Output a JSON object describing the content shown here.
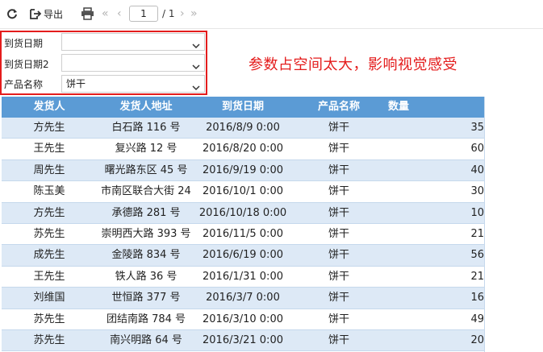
{
  "toolbar": {
    "export_label": "导出",
    "page_current": "1",
    "page_total": "/ 1",
    "icons": [
      "refresh-icon",
      "export-icon",
      "print-icon",
      "first-page-icon",
      "prev-page-icon",
      "next-page-icon",
      "last-page-icon"
    ]
  },
  "params": [
    {
      "label": "到货日期",
      "value": ""
    },
    {
      "label": "到货日期2",
      "value": ""
    },
    {
      "label": "产品名称",
      "value": "饼干"
    }
  ],
  "annotation": "参数占空间太大，影响视觉感受",
  "table": {
    "headers": [
      "发货人",
      "发货人地址",
      "到货日期",
      "产品名称",
      "数量"
    ],
    "rows": [
      [
        "方先生",
        "白石路 116 号",
        "2016/8/9 0:00",
        "饼干",
        "35"
      ],
      [
        "王先生",
        "复兴路 12 号",
        "2016/8/20 0:00",
        "饼干",
        "60"
      ],
      [
        "周先生",
        "曙光路东区 45 号",
        "2016/9/19 0:00",
        "饼干",
        "40"
      ],
      [
        "陈玉美",
        "市南区联合大街 24",
        "2016/10/1 0:00",
        "饼干",
        "30"
      ],
      [
        "方先生",
        "承德路 281 号",
        "2016/10/18 0:00",
        "饼干",
        "10"
      ],
      [
        "苏先生",
        "崇明西大路 393 号",
        "2016/11/5 0:00",
        "饼干",
        "21"
      ],
      [
        "成先生",
        "金陵路 834 号",
        "2016/6/19 0:00",
        "饼干",
        "56"
      ],
      [
        "王先生",
        "铁人路 36 号",
        "2016/1/31 0:00",
        "饼干",
        "21"
      ],
      [
        "刘维国",
        "世恒路 377 号",
        "2016/3/7 0:00",
        "饼干",
        "16"
      ],
      [
        "苏先生",
        "团结南路 784 号",
        "2016/3/10 0:00",
        "饼干",
        "49"
      ],
      [
        "苏先生",
        "南兴明路 64 号",
        "2016/3/21 0:00",
        "饼干",
        "20"
      ]
    ]
  }
}
